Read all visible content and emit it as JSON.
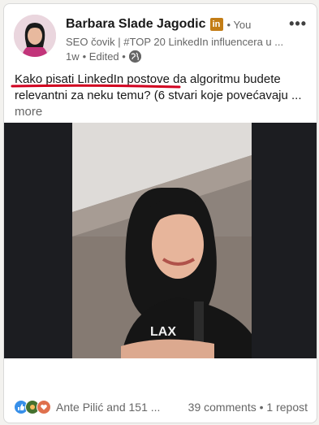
{
  "post": {
    "author": {
      "name": "Barbara Slade Jagodic",
      "badge": "in",
      "connection": "• You",
      "headline": "SEO čovik | #TOP 20 LinkedIn influencera u ...",
      "time": "1w",
      "edited": "• Edited •"
    },
    "more_menu": "•••",
    "text": {
      "body": "Kako pisati LinkedIn postove da algoritmu budete relevantni za neku temu? (6 stvari koje povećavaju ...",
      "more": "more"
    },
    "social": {
      "reactors": "Ante Pilić and 151 ...",
      "comments": "39 comments",
      "separator": "•",
      "reposts": "1 repost"
    }
  },
  "colors": {
    "linkedin_badge": "#c37d16",
    "underline_annotation": "#d1001f",
    "like_blue": "#378fe9",
    "celebrate_green": "#44712e",
    "love_red": "#df704d"
  }
}
